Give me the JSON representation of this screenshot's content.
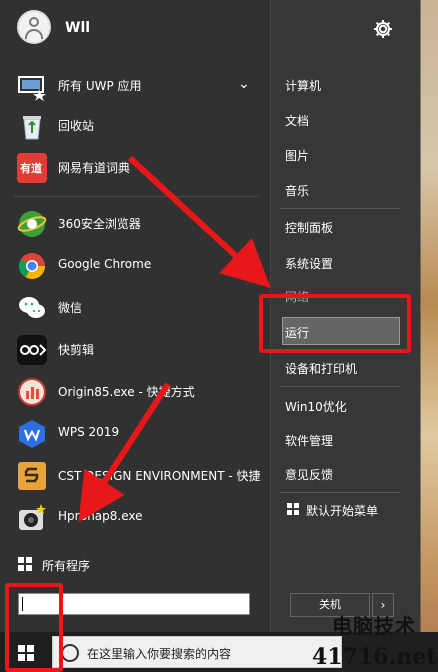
{
  "user": {
    "name": "Wll"
  },
  "left_menu": {
    "all_uwp": "所有 UWP 应用",
    "recycle_bin": "回收站",
    "youdao": "网易有道词典",
    "browser_360": "360安全浏览器",
    "chrome": "Google Chrome",
    "wechat": "微信",
    "kuaijianji": "快剪辑",
    "origin": "Origin85.exe - 快捷方式",
    "wps": "WPS 2019",
    "cst": "CST DESIGN ENVIRONMENT - 快捷",
    "hypersnap": "HprSnap8.exe",
    "all_programs": "所有程序"
  },
  "right_menu": {
    "computer": "计算机",
    "documents": "文档",
    "pictures": "图片",
    "music": "音乐",
    "control_panel": "控制面板",
    "settings": "系统设置",
    "network": "网络",
    "run": "运行",
    "devices": "设备和打印机",
    "win10": "Win10优化",
    "software": "软件管理",
    "feedback": "意见反馈",
    "default_menu": "默认开始菜单"
  },
  "shutdown": {
    "label": "关机",
    "arrow": "›"
  },
  "taskbar": {
    "search_placeholder": "在这里输入你要搜索的内容"
  },
  "watermark": {
    "line1": "电脑技术",
    "line2": "41716.net"
  },
  "colors": {
    "highlight_red": "#e8181a",
    "menu_bg": "#323232",
    "chrome_green": "#34a853"
  }
}
